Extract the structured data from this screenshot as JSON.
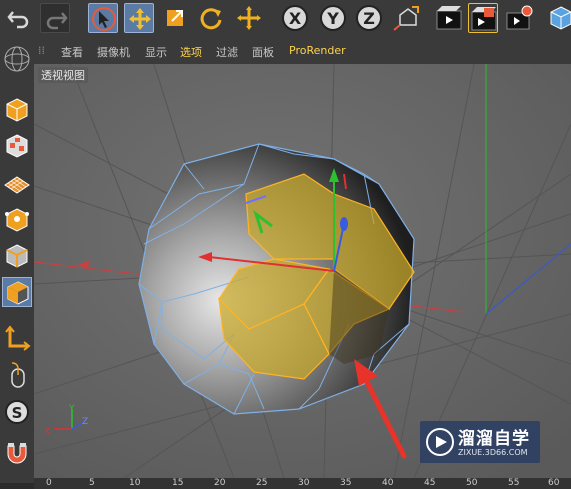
{
  "menu": {
    "items": [
      "查看",
      "摄像机",
      "显示",
      "选项",
      "过滤",
      "面板",
      "ProRender"
    ],
    "active": "选项"
  },
  "viewport": {
    "label": "透视视图"
  },
  "axes": {
    "x_label": "X",
    "y_label": "Y",
    "z_label": "Z"
  },
  "ruler": {
    "ticks": [
      "0",
      "5",
      "10",
      "15",
      "20",
      "25",
      "30",
      "35",
      "40",
      "45",
      "50",
      "55",
      "60"
    ]
  },
  "watermark": {
    "title": "溜溜自学",
    "url": "ZIXUE.3D66.COM"
  },
  "toolbar": {
    "icons": [
      "undo-icon",
      "redo-icon",
      "select-icon",
      "move-icon",
      "scale-icon",
      "rotate-icon",
      "move-tool-icon",
      "x-axis-icon",
      "y-axis-icon",
      "z-axis-icon",
      "coordinate-icon",
      "render-view-icon",
      "render-picture-viewer-icon",
      "render-settings-icon",
      "cube-icon"
    ]
  },
  "colors": {
    "accent_selected": "#5b7ba4",
    "menu_active": "#ffd34d",
    "selection_face": "#c9a72a",
    "edge": "#7fb0e6"
  }
}
